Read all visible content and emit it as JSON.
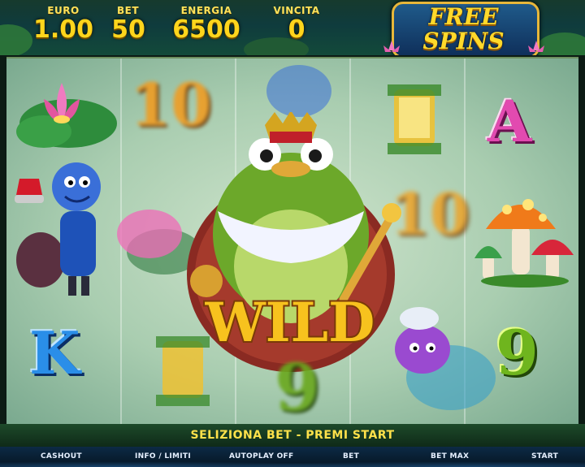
{
  "header": {
    "stats": [
      {
        "label": "EURO",
        "value": "1.00"
      },
      {
        "label": "BET",
        "value": "50"
      },
      {
        "label": "ENERGIA",
        "value": "6500"
      },
      {
        "label": "VINCITA",
        "value": "0"
      }
    ],
    "logo": {
      "line1": "FREE",
      "line2": "SPINS"
    }
  },
  "reels": {
    "symbols": {
      "letter_a": "A",
      "letter_k": "K",
      "nine_right": "9",
      "nine_center": "9",
      "ten_left": "10",
      "ten_blur": "10",
      "wild": "WILD"
    }
  },
  "message": "SELIZIONA BET - PREMI START",
  "buttons": {
    "cashout": "CASHOUT",
    "info": "INFO / LIMITI",
    "autoplay": "AUTOPLAY OFF",
    "bet": "BET",
    "betmax": "BET MAX",
    "start": "START"
  },
  "colors": {
    "label_yellow": "#ffe25a",
    "value_gold": "#ffd51c",
    "reel_bg": "#a9cdb0",
    "wild_gold": "#f7c21e",
    "button_bar": "#0c2a45"
  }
}
